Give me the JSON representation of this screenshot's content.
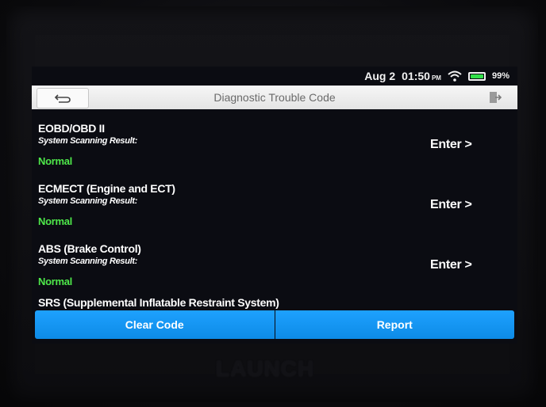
{
  "status_bar": {
    "date": "Aug 2",
    "time": "01:50",
    "time_suffix": "PM",
    "battery": "99%",
    "battery_level": 0.99,
    "wifi_icon": "wifi-icon",
    "battery_icon": "battery-icon"
  },
  "title_bar": {
    "title": "Diagnostic Trouble Code",
    "back_icon": "back-arrow-icon",
    "exit_icon": "exit-icon"
  },
  "systems": [
    {
      "name": "EOBD/OBD II",
      "subtitle": "System Scanning Result:",
      "status": "Normal",
      "action": "Enter >"
    },
    {
      "name": "ECMECT (Engine and ECT)",
      "subtitle": "System Scanning Result:",
      "status": "Normal",
      "action": "Enter >"
    },
    {
      "name": "ABS (Brake Control)",
      "subtitle": "System Scanning Result:",
      "status": "Normal",
      "action": "Enter >"
    },
    {
      "name": "SRS (Supplemental Inflatable Restraint System)"
    }
  ],
  "buttons": {
    "clear_code": "Clear Code",
    "report": "Report"
  },
  "colors": {
    "status_normal": "#4ee84a",
    "button_blue": "#1ea1ff",
    "title_bar_bg": "#f0f0f0",
    "screen_bg": "#0b0c12"
  },
  "device_brand": "LAUNCH"
}
